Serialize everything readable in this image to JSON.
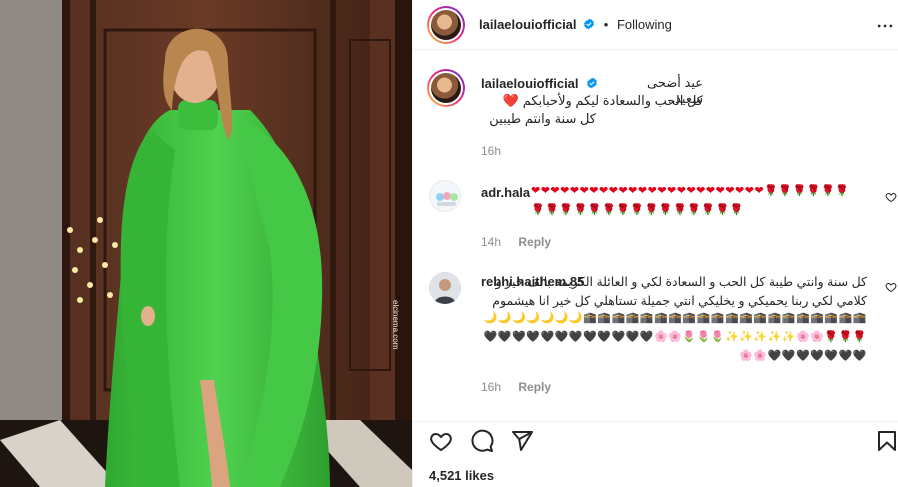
{
  "post": {
    "username": "lailaelouiofficial",
    "separator": "•",
    "follow_status": "Following",
    "photo_watermark": "elcinema.com"
  },
  "caption": {
    "username": "lailaelouiofficial",
    "lines": [
      "عيد أضحى سعيد..",
      "كل الحب والسعادة ليكم ولأحبابكم ❤️",
      "كل سنة وانتم طيبين"
    ],
    "time": "16h"
  },
  "comments": [
    {
      "username": "adr.hala",
      "text": "❤❤❤❤❤❤❤❤❤❤❤❤❤❤❤❤❤❤❤❤❤❤❤❤🌹🌹🌹🌹🌹🌹🌹🌹🌹🌹🌹🌹🌹🌹🌹🌹🌹🌹🌹🌹🌹",
      "time": "14h",
      "reply_label": "Reply"
    },
    {
      "username": "rebhi.haithem.85",
      "text": "كل سنة وانتي طيبة كل الحب و السعادة لكي و العائلة الكريمة بالف خير و كلامي لكي ربنا يحميكي و يخليكي انتي جميلة تستاهلي كل خير انا هيشموم",
      "emojis": "🕋🕋🕋🕋🕋🕋🕋🕋🕋🕋🕋🕋🕋🕋🕋🕋🕋🕋🕋🕋🌙🌙🌙🌙🌙🌙🌙🌹🌹🌹🌸🌸✨✨✨✨✨🌷🌷🌷🌸🌸🖤🖤🖤🖤🖤🖤🖤🖤🖤🖤🖤🖤🖤🖤🖤🖤🖤🖤🖤🌸🌸",
      "time": "16h",
      "reply_label": "Reply"
    }
  ],
  "likes": "4,521 likes",
  "icons": {
    "verified": "verified-badge-icon",
    "more": "more-options-icon",
    "like": "heart-icon",
    "comment": "comment-icon",
    "share": "share-icon",
    "save": "bookmark-icon"
  },
  "colors": {
    "verified_blue": "#0095f6",
    "muted": "#8e8e8e",
    "dress_green": "#3fbf3f"
  }
}
